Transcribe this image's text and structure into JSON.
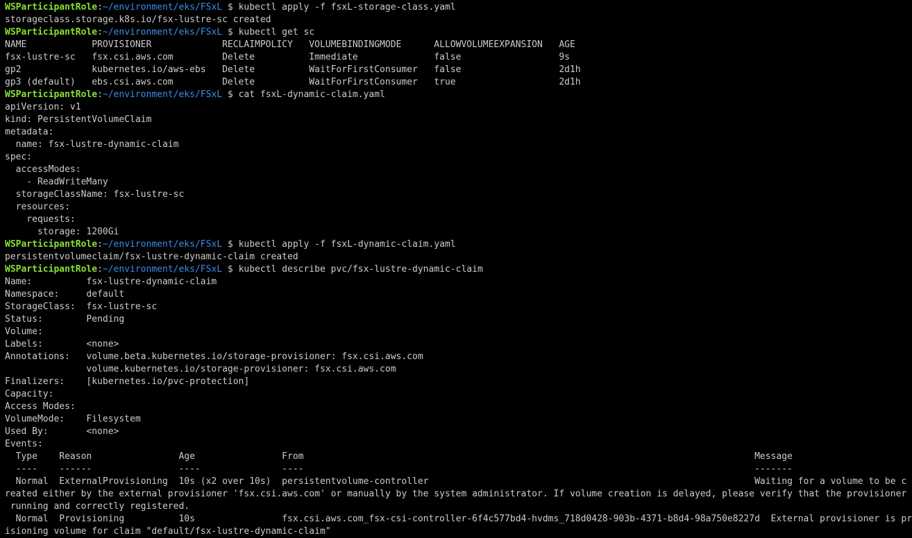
{
  "colors": {
    "background": "#000000",
    "text": "#cccccc",
    "prompt_user": "#8ae234",
    "prompt_path": "#3b8eea"
  },
  "prompt": {
    "user": "WSParticipantRole",
    "sep": ":",
    "path": "~/environment/eks/FSxL",
    "symbol": " $ "
  },
  "lines": [
    {
      "type": "prompt",
      "cmd": "kubectl apply -f fsxL-storage-class.yaml"
    },
    {
      "type": "output",
      "text": "storageclass.storage.k8s.io/fsx-lustre-sc created"
    },
    {
      "type": "prompt",
      "cmd": "kubectl get sc"
    },
    {
      "type": "output",
      "text": "NAME            PROVISIONER             RECLAIMPOLICY   VOLUMEBINDINGMODE      ALLOWVOLUMEEXPANSION   AGE"
    },
    {
      "type": "output",
      "text": "fsx-lustre-sc   fsx.csi.aws.com         Delete          Immediate              false                  9s"
    },
    {
      "type": "output",
      "text": "gp2             kubernetes.io/aws-ebs   Delete          WaitForFirstConsumer   false                  2d1h"
    },
    {
      "type": "output",
      "text": "gp3 (default)   ebs.csi.aws.com         Delete          WaitForFirstConsumer   true                   2d1h"
    },
    {
      "type": "prompt",
      "cmd": "cat fsxL-dynamic-claim.yaml"
    },
    {
      "type": "output",
      "text": "apiVersion: v1"
    },
    {
      "type": "output",
      "text": "kind: PersistentVolumeClaim"
    },
    {
      "type": "output",
      "text": "metadata:"
    },
    {
      "type": "output",
      "text": "  name: fsx-lustre-dynamic-claim"
    },
    {
      "type": "output",
      "text": "spec:"
    },
    {
      "type": "output",
      "text": "  accessModes:"
    },
    {
      "type": "output",
      "text": "    - ReadWriteMany"
    },
    {
      "type": "output",
      "text": "  storageClassName: fsx-lustre-sc"
    },
    {
      "type": "output",
      "text": "  resources:"
    },
    {
      "type": "output",
      "text": "    requests:"
    },
    {
      "type": "output",
      "text": "      storage: 1200Gi"
    },
    {
      "type": "prompt",
      "cmd": "kubectl apply -f fsxL-dynamic-claim.yaml"
    },
    {
      "type": "output",
      "text": "persistentvolumeclaim/fsx-lustre-dynamic-claim created"
    },
    {
      "type": "prompt",
      "cmd": "kubectl describe pvc/fsx-lustre-dynamic-claim"
    },
    {
      "type": "output",
      "text": "Name:          fsx-lustre-dynamic-claim"
    },
    {
      "type": "output",
      "text": "Namespace:     default"
    },
    {
      "type": "output",
      "text": "StorageClass:  fsx-lustre-sc"
    },
    {
      "type": "output",
      "text": "Status:        Pending"
    },
    {
      "type": "output",
      "text": "Volume:"
    },
    {
      "type": "output",
      "text": "Labels:        <none>"
    },
    {
      "type": "output",
      "text": "Annotations:   volume.beta.kubernetes.io/storage-provisioner: fsx.csi.aws.com"
    },
    {
      "type": "output",
      "text": "               volume.kubernetes.io/storage-provisioner: fsx.csi.aws.com"
    },
    {
      "type": "output",
      "text": "Finalizers:    [kubernetes.io/pvc-protection]"
    },
    {
      "type": "output",
      "text": "Capacity:"
    },
    {
      "type": "output",
      "text": "Access Modes:"
    },
    {
      "type": "output",
      "text": "VolumeMode:    Filesystem"
    },
    {
      "type": "output",
      "text": "Used By:       <none>"
    },
    {
      "type": "output",
      "text": "Events:"
    },
    {
      "type": "output",
      "text": "  Type    Reason                Age                From                                                                                   Message"
    },
    {
      "type": "output",
      "text": "  ----    ------                ----               ----                                                                                   -------"
    },
    {
      "type": "output",
      "text": "  Normal  ExternalProvisioning  10s (x2 over 10s)  persistentvolume-controller                                                            Waiting for a volume to be c"
    },
    {
      "type": "output",
      "text": "reated either by the external provisioner 'fsx.csi.aws.com' or manually by the system administrator. If volume creation is delayed, please verify that the provisioner is"
    },
    {
      "type": "output",
      "text": " running and correctly registered."
    },
    {
      "type": "output",
      "text": "  Normal  Provisioning          10s                fsx.csi.aws.com_fsx-csi-controller-6f4c577bd4-hvdms_718d0428-903b-4371-b8d4-98a750e8227d  External provisioner is prov"
    },
    {
      "type": "output",
      "text": "isioning volume for claim \"default/fsx-lustre-dynamic-claim\""
    }
  ]
}
